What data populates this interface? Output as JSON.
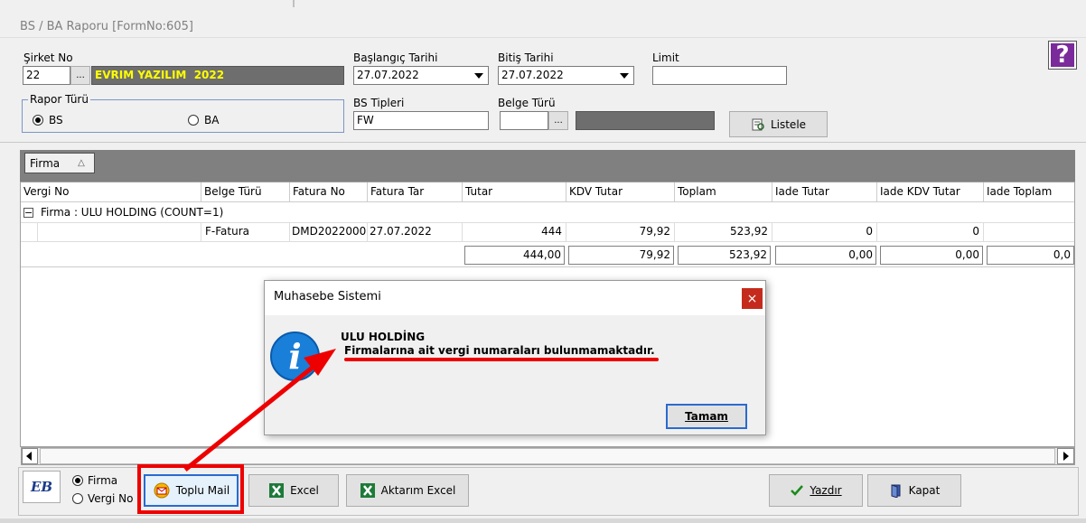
{
  "window": {
    "title": "BS / BA Raporu [FormNo:605]"
  },
  "filters": {
    "company_label": "Şirket No",
    "company_no": "22",
    "company_name": "EVRIM YAZILIM  2022",
    "start_label": "Başlangıç Tarihi",
    "start_date": "27.07.2022",
    "end_label": "Bitiş Tarihi",
    "end_date": "27.07.2022",
    "limit_label": "Limit",
    "limit_value": "",
    "report_type_label": "Rapor Türü",
    "report_bs": "BS",
    "report_ba": "BA",
    "bs_types_label": "BS Tipleri",
    "bs_types_value": "FW",
    "doc_type_label": "Belge Türü",
    "doc_type_value": "",
    "list_button": "Listele",
    "ellipsis": "..."
  },
  "group_panel": {
    "chip": "Firma",
    "sort_glyph": "△"
  },
  "grid": {
    "columns": [
      "Vergi No",
      "Belge Türü",
      "Fatura No",
      "Fatura Tar",
      "Tutar",
      "KDV Tutar",
      "Toplam",
      "Iade Tutar",
      "Iade KDV Tutar",
      "Iade Toplam"
    ],
    "group_row": "Firma : ULU HOLDING (COUNT=1)",
    "expander": "−",
    "rows": [
      {
        "vergi_no": "",
        "belge_turu": "F-Fatura",
        "fatura_no": "DMD2022000",
        "fatura_tar": "27.07.2022",
        "tutar": "444",
        "kdv_tutar": "79,92",
        "toplam": "523,92",
        "iade_tutar": "0",
        "iade_kdv": "0",
        "iade_toplam": ""
      }
    ],
    "summary": {
      "tutar": "444,00",
      "kdv_tutar": "79,92",
      "toplam": "523,92",
      "iade_tutar": "0,00",
      "iade_kdv": "0,00",
      "iade_toplam": "0,0"
    }
  },
  "dialog": {
    "title": "Muhasebe Sistemi",
    "close": "×",
    "heading": "ULU HOLDİNG",
    "message": "Firmalarına ait vergi numaraları bulunmamaktadır.",
    "ok_button": "Tamam"
  },
  "bottom": {
    "logo_text": "EB",
    "radio_firma": "Firma",
    "radio_vergi": "Vergi No",
    "mail_button": "Toplu Mail",
    "excel_button": "Excel",
    "transfer_excel_button": "Aktarım Excel",
    "print_button": "Yazdır",
    "close_button": "Kapat"
  },
  "help_glyph": "?",
  "colors": {
    "company_bg": "#6e6e6e",
    "company_text": "#ffff00",
    "highlight_red": "#ee0000",
    "info_blue": "#1a7fd8",
    "help_purple": "#7a2a9a"
  }
}
